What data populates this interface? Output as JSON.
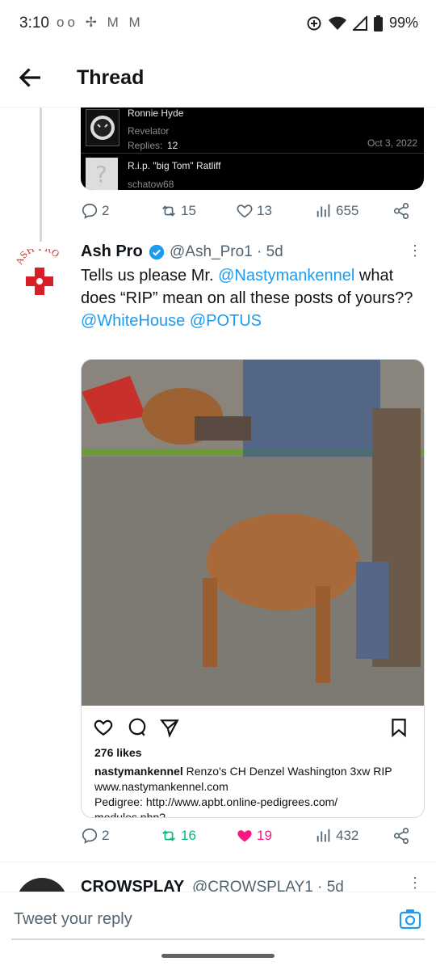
{
  "status_bar": {
    "time": "3:10",
    "notification_icons": "oo ✢ M M",
    "battery": "99%"
  },
  "header": {
    "title": "Thread"
  },
  "embedded_post": {
    "row1_name": "Ronnie Hyde",
    "row1_sub": "Revelator",
    "row1_replies_label": "Replies:",
    "row1_replies": "12",
    "row1_date": "Oct 3, 2022",
    "row2_title": "R.i.p. \"big Tom\" Ratliff",
    "row2_sub": "schatow68"
  },
  "tweet1_actions": {
    "replies": "2",
    "retweets": "15",
    "likes": "13",
    "views": "655"
  },
  "tweet2": {
    "avatar_text": "ASH PRO",
    "name": "Ash Pro",
    "handle_time": "@Ash_Pro1 · 5d",
    "text_part1": "Tells us please Mr. ",
    "mention1": "@Nastymankennel",
    "text_part2": " what does “RIP” mean on all these posts of yours??",
    "mention2": "@WhiteHouse",
    "mention3": "@POTUS",
    "card": {
      "likes": "276 likes",
      "caption_user": "nastymankennel",
      "caption_text": " Renzo's CH Denzel Washington 3xw RIP",
      "caption_line2": "www.nastymankennel.com",
      "caption_line3": "Pedigree: http://www.apbt.online-pedigrees.com/",
      "caption_line4": "modules.php?"
    },
    "actions": {
      "replies": "2",
      "retweets": "16",
      "likes": "19",
      "views": "432"
    }
  },
  "tweet3": {
    "name": "CROWSPLAY",
    "handle_time": "@CROWSPLAY1 · 5d"
  },
  "reply_bar": {
    "placeholder": "Tweet your reply"
  },
  "colors": {
    "link": "#1d9bf0",
    "retweet_active": "#00ba7c",
    "like_active": "#f91880",
    "muted": "#536471"
  }
}
